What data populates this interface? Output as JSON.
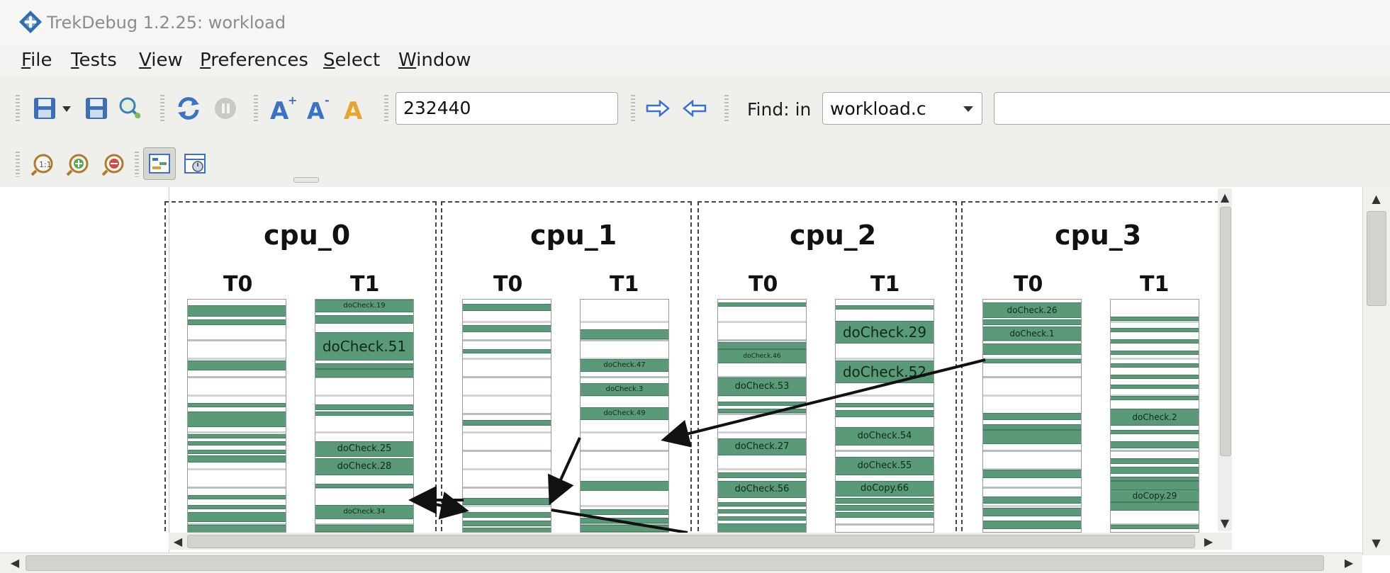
{
  "window": {
    "title": "TrekDebug 1.2.25: workload"
  },
  "menu": [
    {
      "label": "File",
      "mnemonic": "F",
      "rest": "ile"
    },
    {
      "label": "Tests",
      "mnemonic": "T",
      "rest": "ests"
    },
    {
      "label": "View",
      "mnemonic": "V",
      "rest": "iew"
    },
    {
      "label": "Preferences",
      "mnemonic": "P",
      "rest": "references"
    },
    {
      "label": "Select",
      "mnemonic": "S",
      "rest": "elect"
    },
    {
      "label": "Window",
      "mnemonic": "W",
      "rest": "indow"
    }
  ],
  "toolbar": {
    "goto_value": "232440",
    "find_label": "Find: in",
    "find_scope": "workload.c",
    "find_text": ""
  },
  "icons": {
    "save_menu": "save-dropdown-icon",
    "save": "save-icon",
    "find_file": "magnify-file-icon",
    "refresh": "refresh-icon",
    "stop": "stop-icon",
    "font_larger": "font-increase-icon",
    "font_smaller": "font-decrease-icon",
    "font_reset": "font-reset-icon",
    "forward": "arrow-right-icon",
    "back": "arrow-left-icon",
    "zoom_fit": "zoom-fit-icon",
    "zoom_in": "zoom-in-icon",
    "zoom_out": "zoom-out-icon",
    "view_graph": "graph-view-icon",
    "view_table": "table-view-icon"
  },
  "colors": {
    "task_fill": "#5a9a78",
    "task_border": "#3f7d5c",
    "arrow_blue": "#3a6fd0"
  },
  "cpus": [
    {
      "name": "cpu_0",
      "threads": [
        {
          "name": "T0",
          "labels": []
        },
        {
          "name": "T1",
          "labels": [
            "doCheck.19",
            "doCheck.51",
            "doCheck.25",
            "doCheck.28",
            "doCheck.34"
          ]
        }
      ]
    },
    {
      "name": "cpu_1",
      "threads": [
        {
          "name": "T0",
          "labels": []
        },
        {
          "name": "T1",
          "labels": [
            "doCheck.47",
            "doCheck.3",
            "doCheck.49"
          ]
        }
      ]
    },
    {
      "name": "cpu_2",
      "threads": [
        {
          "name": "T0",
          "labels": [
            "doCheck.46",
            "doCheck.53",
            "doCheck.27",
            "doCheck.56"
          ]
        },
        {
          "name": "T1",
          "labels": [
            "doCheck.29",
            "doCheck.52",
            "doCheck.54",
            "doCheck.55",
            "doCopy.66"
          ]
        }
      ]
    },
    {
      "name": "cpu_3",
      "threads": [
        {
          "name": "T0",
          "labels": [
            "doCheck.26",
            "doCheck.1"
          ]
        },
        {
          "name": "T1",
          "labels": [
            "doCheck.2",
            "doCopy.29"
          ]
        }
      ]
    }
  ]
}
